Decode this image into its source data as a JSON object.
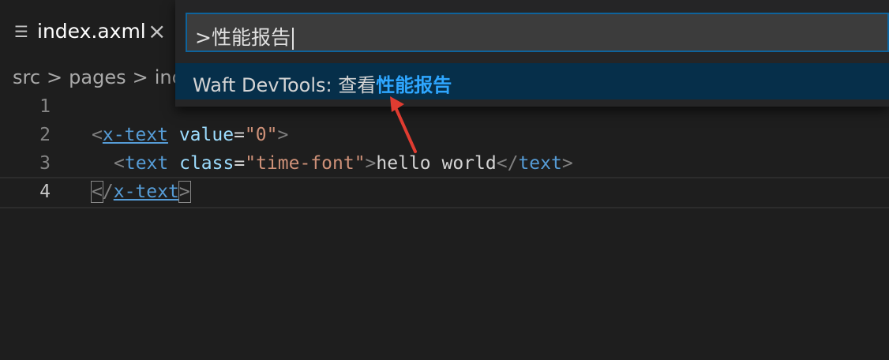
{
  "tab": {
    "icon": "menu-lines-icon",
    "label": "index.axml",
    "close": "×"
  },
  "breadcrumb": [
    "src",
    "pages",
    "inc"
  ],
  "breadcrumb_separator": ">",
  "editor": {
    "lines": [
      {
        "number": "1"
      },
      {
        "number": "2",
        "open_bracket": "<",
        "tag": "x-text",
        "attr": "value",
        "eq": "=",
        "value": "\"0\"",
        "close_bracket": ">"
      },
      {
        "number": "3",
        "open_bracket": "<",
        "tag": "text",
        "attr": "class",
        "eq": "=",
        "value": "\"time-font\"",
        "close_bracket": ">",
        "text": "hello world",
        "end_open": "</",
        "end_tag": "text",
        "end_close": ">"
      },
      {
        "number": "4",
        "end_open_lt": "<",
        "slash": "/",
        "tag": "x-text",
        "end_close": ">"
      }
    ]
  },
  "command_palette": {
    "input_value": ">性能报告",
    "result": {
      "prefix": "Waft DevTools: 查看",
      "match": "性能报告"
    }
  },
  "colors": {
    "accent": "#2ea6ff",
    "arrow": "#e03c31",
    "selection": "#062f4a"
  }
}
